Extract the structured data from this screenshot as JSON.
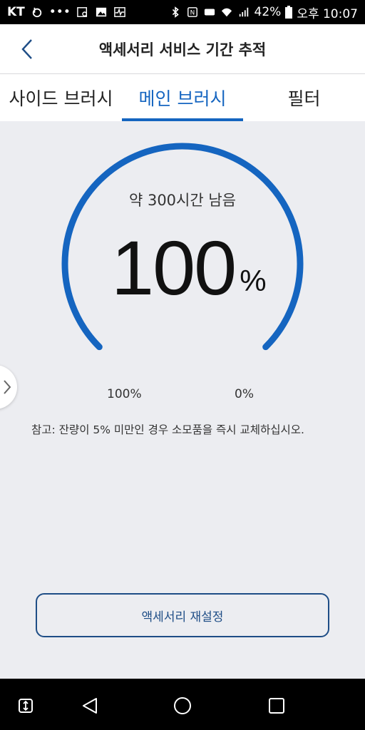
{
  "status_bar": {
    "carrier": "KT",
    "battery": "42%",
    "time": "오후 10:07"
  },
  "header": {
    "title": "액세서리 서비스 기간 추적"
  },
  "tabs": [
    {
      "label": "사이드 브러시"
    },
    {
      "label": "메인 브러시",
      "active": true
    },
    {
      "label": "필터"
    }
  ],
  "gauge": {
    "remaining_text": "약 300시간 남음",
    "percent_value": "100",
    "percent_sign": "%",
    "level": 1.0,
    "range_start_label": "100%",
    "range_end_label": "0%",
    "color": "#1565c0"
  },
  "note": "참고: 잔량이 5% 미만인 경우 소모품을 즉시 교체하십시오.",
  "reset_button": {
    "label": "액세서리 재설정"
  }
}
